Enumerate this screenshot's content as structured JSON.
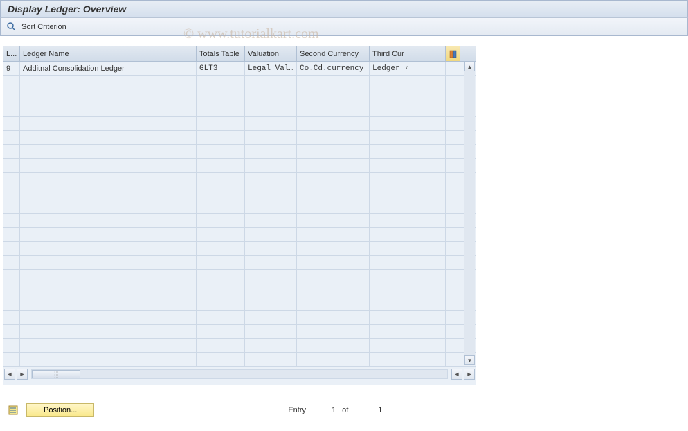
{
  "title": "Display Ledger: Overview",
  "toolbar": {
    "sort_criterion": "Sort Criterion"
  },
  "watermark": "© www.tutorialkart.com",
  "columns": {
    "l": "L...",
    "name": "Ledger Name",
    "totals": "Totals Table",
    "valuation": "Valuation",
    "second": "Second Currency",
    "third": "Third Cur"
  },
  "rows": [
    {
      "l": "9",
      "name": "Additnal Consolidation Ledger",
      "totals": "GLT3",
      "valuation": "Legal Val…",
      "second": "Co.Cd.currency",
      "third": "Ledger ‹"
    }
  ],
  "footer": {
    "position_label": "Position...",
    "entry_label": "Entry",
    "entry_current": "1",
    "of_label": "of",
    "entry_total": "1"
  }
}
